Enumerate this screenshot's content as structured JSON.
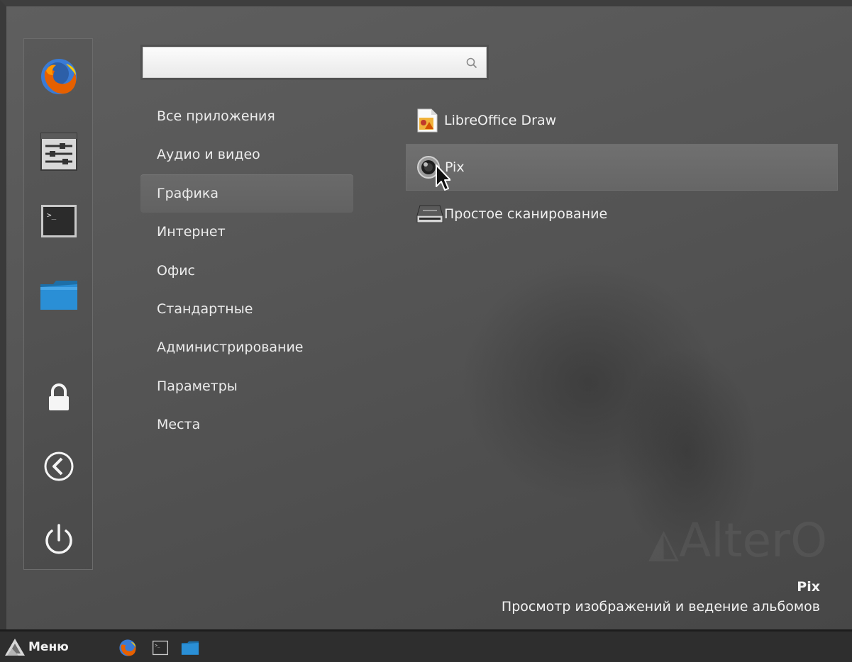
{
  "search": {
    "value": "",
    "placeholder": ""
  },
  "categories": [
    {
      "label": "Все приложения",
      "active": false
    },
    {
      "label": "Аудио и видео",
      "active": false
    },
    {
      "label": "Графика",
      "active": true
    },
    {
      "label": "Интернет",
      "active": false
    },
    {
      "label": "Офис",
      "active": false
    },
    {
      "label": "Стандартные",
      "active": false
    },
    {
      "label": "Администрирование",
      "active": false
    },
    {
      "label": "Параметры",
      "active": false
    },
    {
      "label": "Места",
      "active": false
    }
  ],
  "apps": [
    {
      "label": "LibreOffice Draw",
      "icon": "libreoffice-draw-icon",
      "active": false
    },
    {
      "label": "Pix",
      "icon": "pix-camera-icon",
      "active": true
    },
    {
      "label": "Простое сканирование",
      "icon": "scanner-icon",
      "active": false
    }
  ],
  "favorites": [
    "firefox-icon",
    "settings-sliders-icon",
    "terminal-icon",
    "folder-icon"
  ],
  "session_buttons": [
    "lock-icon",
    "logout-icon",
    "power-icon"
  ],
  "description": {
    "title": "Pix",
    "text": "Просмотр изображений и ведение альбомов"
  },
  "watermark": {
    "text": "AlterO"
  },
  "taskbar": {
    "menu_label": "Меню",
    "launchers": [
      "firefox-icon",
      "terminal-icon",
      "folder-icon"
    ]
  },
  "colors": {
    "panel_bg": "#575757",
    "taskbar_bg": "#2e2e2e",
    "text": "#ececec",
    "highlight": "#6a6a6a"
  }
}
